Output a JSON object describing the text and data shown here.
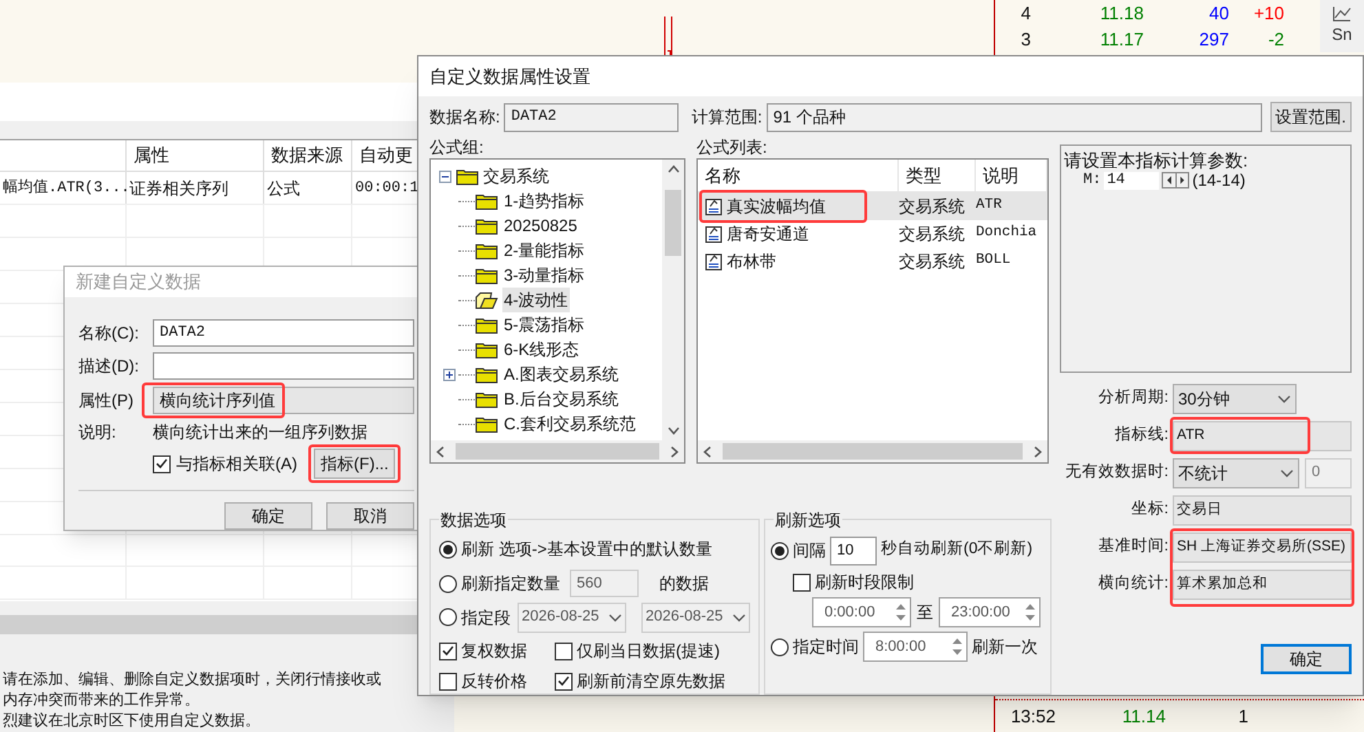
{
  "ticker": {
    "rows": [
      {
        "number": "4",
        "price": "11.18",
        "volume": "40",
        "change": "+10",
        "color": "#ff0000"
      },
      {
        "number": "3",
        "price": "11.17",
        "volume": "297",
        "change": "-2",
        "color": "#008000"
      }
    ],
    "side_label": "Sn",
    "bottom_row": {
      "time": "13:52",
      "price": "11.14",
      "volume": "1"
    }
  },
  "list_window": {
    "columns": [
      "",
      "属性",
      "数据来源",
      "自动更"
    ],
    "rows": [
      {
        "cells": [
          "幅均值.ATR(3...",
          "证券相关序列",
          "公式",
          "00:00:1"
        ]
      }
    ],
    "notes": [
      "请在添加、编辑、删除自定义数据项时，关闭行情接收或",
      "内存冲突而带来的工作异常。",
      "烈建议在北京时区下使用自定义数据。"
    ]
  },
  "new_dialog": {
    "title": "新建自定义数据",
    "name": {
      "label": "名称(C):",
      "value": "DATA2"
    },
    "description_field": {
      "label": "描述(D):"
    },
    "property": {
      "label": "属性(P)",
      "value": "横向统计序列值"
    },
    "explanation": {
      "label": "说明:",
      "text": "横向统计出来的一组序列数据"
    },
    "link_checkbox": {
      "label": "与指标相关联(A)",
      "checked": true
    },
    "indicator_button": "指标(F)...",
    "buttons": [
      "确定",
      "取消"
    ]
  },
  "main_dialog": {
    "title": "自定义数据属性设置",
    "data_name": {
      "label": "数据名称:",
      "value": "DATA2"
    },
    "calc_range": {
      "label": "计算范围:",
      "value": "91 个品种",
      "button": "设置范围."
    },
    "formula_group": {
      "label": "公式组:",
      "tree": {
        "label": "交易系统",
        "expanded": true,
        "children": [
          {
            "label": "1-趋势指标",
            "selected": false
          },
          {
            "label": "20250825",
            "selected": false
          },
          {
            "label": "2-量能指标",
            "selected": false
          },
          {
            "label": "3-动量指标",
            "selected": false
          },
          {
            "label": "4-波动性",
            "selected": true
          },
          {
            "label": "5-震荡指标",
            "selected": false
          },
          {
            "label": "6-K线形态",
            "selected": false
          },
          {
            "label": "A.图表交易系统",
            "selected": false,
            "expanded": false
          },
          {
            "label": "B.后台交易系统",
            "selected": false
          },
          {
            "label": "C.套利交易系统范",
            "selected": false
          }
        ]
      }
    },
    "formula_list": {
      "label": "公式列表:",
      "columns": [
        "名称",
        "类型",
        "说明"
      ],
      "rows": [
        {
          "name": "真实波幅均值",
          "type": "交易系统",
          "description": "ATR",
          "selected": true
        },
        {
          "name": "唐奇安通道",
          "type": "交易系统",
          "description": "Donchia",
          "selected": false
        },
        {
          "name": "布林带",
          "type": "交易系统",
          "description": "BOLL",
          "selected": false
        }
      ]
    },
    "params": {
      "prompt": "请设置本指标计算参数:",
      "items": [
        {
          "label": "M:",
          "value": "14",
          "range": "(14-14)"
        }
      ]
    },
    "settings": [
      {
        "kind": "dropdown",
        "label": "分析周期:",
        "value": "30分钟"
      },
      {
        "kind": "readonly",
        "label": "指标线:",
        "value": "ATR"
      },
      {
        "kind": "dropdown",
        "label": "无有效数据时:",
        "value": "不统计",
        "extra_value": "0"
      },
      {
        "kind": "readonly",
        "label": "坐标:",
        "value": "交易日"
      },
      {
        "kind": "readonly",
        "label": "基准时间:",
        "value": "SH 上海证券交易所(SSE)"
      },
      {
        "kind": "readonly",
        "label": "横向统计:",
        "value": "算术累加总和"
      }
    ],
    "data_options": {
      "title": "数据选项",
      "radios": [
        {
          "kind": "plain",
          "label": "刷新 选项->基本设置中的默认数量",
          "selected": true
        },
        {
          "kind": "count",
          "label": "刷新指定数量",
          "value": "560",
          "suffix": "的数据",
          "selected": false,
          "disabled": true
        },
        {
          "kind": "range",
          "label": "指定段",
          "from": "2026-08-25",
          "to": "2026-08-25",
          "selected": false,
          "disabled": true
        }
      ],
      "checkboxes": [
        {
          "label": "复权数据",
          "checked": true
        },
        {
          "label": "仅刷当日数据(提速)",
          "checked": false
        },
        {
          "label": "反转价格",
          "checked": false
        },
        {
          "label": "刷新前清空原先数据",
          "checked": true
        }
      ]
    },
    "refresh_options": {
      "title": "刷新选项",
      "interval": {
        "label": "间隔",
        "value": "10",
        "suffix": "秒自动刷新(0不刷新)",
        "selected": true
      },
      "time_limit": {
        "label": "刷新时段限制",
        "checked": false
      },
      "start": "0:00:00",
      "to_label": "至",
      "end": "23:00:00",
      "timed": {
        "label": "指定时间",
        "value": "8:00:00",
        "suffix": "刷新一次",
        "selected": false
      }
    },
    "ok_button": "确定"
  }
}
